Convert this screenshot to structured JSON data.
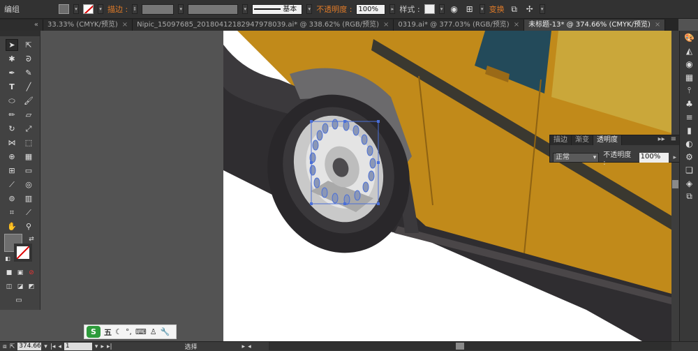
{
  "controlbar": {
    "selection_label": "编组",
    "stroke_label": "描边 :",
    "stroke_style": "基本",
    "opacity_label": "不透明度 :",
    "opacity_value": "100%",
    "style_label": "样式 :",
    "transform_label": "变换"
  },
  "tabs": [
    {
      "label": "33.33% (CMYK/预览)"
    },
    {
      "label": "Nipic_15097685_20180412182947978039.ai* @ 338.62% (RGB/预览)"
    },
    {
      "label": "0319.ai* @ 377.03% (RGB/预览)"
    },
    {
      "label": "未标题-13* @ 374.66% (CMYK/预览)"
    }
  ],
  "tab_collapse": "«",
  "tab_close": "×",
  "transparency_panel": {
    "tabs": [
      "描边",
      "渐变",
      "透明度"
    ],
    "blend_mode": "正常",
    "opacity_label": "不透明度 :",
    "opacity_value": "100%"
  },
  "status": {
    "zoom": "374.66",
    "page": "1",
    "tool": "选择"
  },
  "ime": {
    "logo": "S",
    "mode": "五"
  },
  "colors": {
    "car_body": "#c18a1a",
    "car_dark": "#2f2d30",
    "wheel_outer": "#29272a",
    "rim": "#c9c9c9",
    "selection": "#4a6fd8",
    "accent": "#e07b28"
  }
}
